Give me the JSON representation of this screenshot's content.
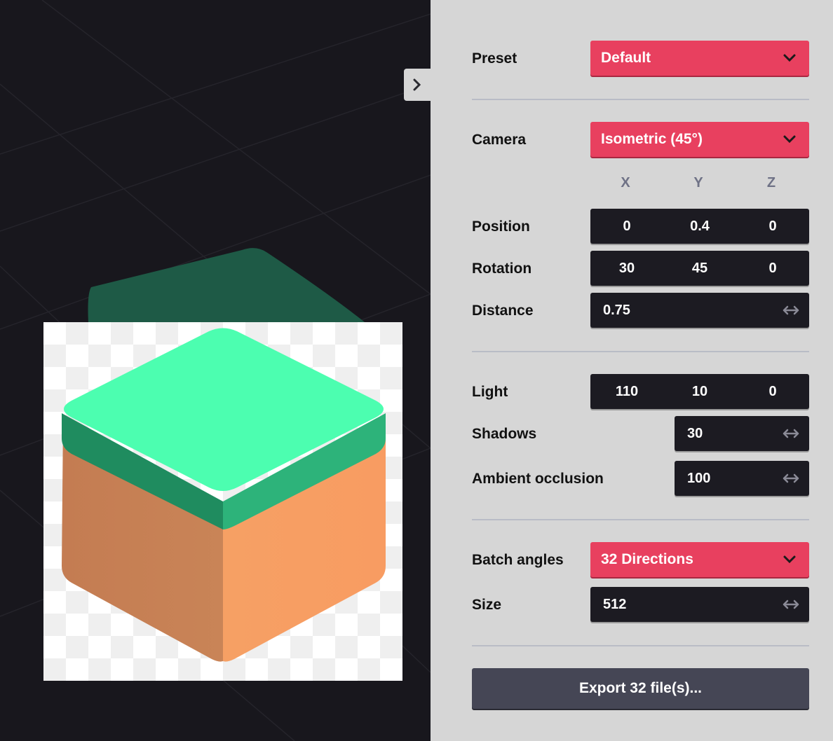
{
  "panel": {
    "preset": {
      "label": "Preset",
      "value": "Default"
    },
    "camera": {
      "label": "Camera",
      "value": "Isometric (45°)"
    },
    "axes": [
      "X",
      "Y",
      "Z"
    ],
    "position": {
      "label": "Position",
      "x": "0",
      "y": "0.4",
      "z": "0"
    },
    "rotation": {
      "label": "Rotation",
      "x": "30",
      "y": "45",
      "z": "0"
    },
    "distance": {
      "label": "Distance",
      "value": "0.75"
    },
    "light": {
      "label": "Light",
      "x": "110",
      "y": "10",
      "z": "0"
    },
    "shadows": {
      "label": "Shadows",
      "value": "30"
    },
    "ambient_occlusion": {
      "label": "Ambient occlusion",
      "value": "100"
    },
    "batch_angles": {
      "label": "Batch angles",
      "value": "32 Directions"
    },
    "size": {
      "label": "Size",
      "value": "512"
    },
    "export_label": "Export 32 file(s)..."
  },
  "colors": {
    "accent": "#e8405f",
    "panel_bg": "#d6d6d6",
    "field_bg": "#1c1b22",
    "viewport_bg": "#18171d",
    "cube_top": "#4cfeb0",
    "cube_side_left": "#c77f54",
    "cube_side_right": "#f79f63"
  },
  "icons": {
    "toggle": "chevron-right-icon",
    "select": "chevron-down-icon",
    "drag": "horizontal-drag-arrows-icon"
  }
}
